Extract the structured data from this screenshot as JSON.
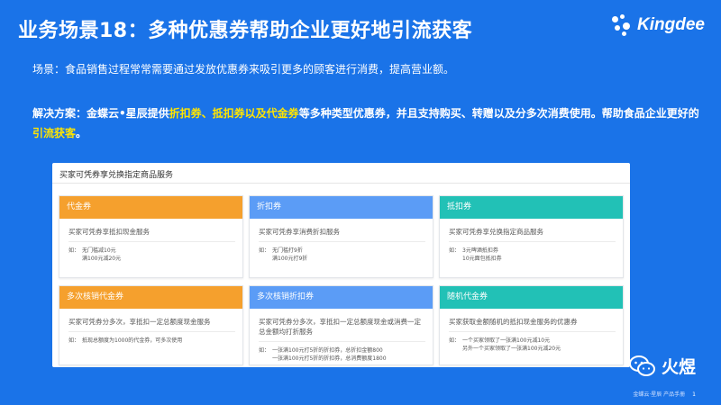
{
  "title": "业务场景18：多种优惠券帮助企业更好地引流获客",
  "logo_text": "Kingdee",
  "scene": "场景：食品销售过程常常需要通过发放优惠券来吸引更多的顾客进行消费，提高营业额。",
  "solution": {
    "prefix": "解决方案：金蝶云•星辰提供",
    "highlight1": "折扣券、抵扣券以及代金券",
    "middle": "等多种类型优惠券，并且支持购买、转赠以及分多次消费使用。帮助食品企业更好的",
    "highlight2": "引流获客",
    "suffix": "。"
  },
  "panel": {
    "heading": "买家可凭券享兑换指定商品服务",
    "cards": [
      {
        "title": "代金券",
        "color": "#f5a02d",
        "desc": "买家可凭券享抵扣现金服务",
        "ex_label": "如：",
        "ex_lines": [
          "无门槛减10元",
          "满100元减20元"
        ]
      },
      {
        "title": "折扣券",
        "color": "#5b9cf6",
        "desc": "买家可凭券享消费折扣服务",
        "ex_label": "如：",
        "ex_lines": [
          "无门槛打9折",
          "满100元打9折"
        ]
      },
      {
        "title": "抵扣券",
        "color": "#22c1b6",
        "desc": "买家可凭券享兑换指定商品服务",
        "ex_label": "如：",
        "ex_lines": [
          "3元啤酒抵扣券",
          "10元面包抵扣券"
        ]
      },
      {
        "title": "多次核销代金券",
        "color": "#f5a02d",
        "desc": "买家可凭券分多次，享抵扣一定总额度现金服务",
        "ex_label": "如：",
        "ex_lines": [
          "抵现总额度为1000的代金券，可多次使用"
        ]
      },
      {
        "title": "多次核销折扣券",
        "color": "#5b9cf6",
        "desc": "买家可凭券分多次，享抵扣一定总额度现金或消费一定总金额均打折服务",
        "ex_label": "如：",
        "ex_lines": [
          "一张满100元打5折的折扣券，总折扣金额800",
          "一张满100元打5折的折扣券，总消费额度1800"
        ]
      },
      {
        "title": "随机代金券",
        "color": "#22c1b6",
        "desc": "买家获取金额随机的抵扣现金服务的优惠券",
        "ex_label": "如：",
        "ex_lines": [
          "一个买家领取了一张满100元减10元",
          "另外一个买家领取了一张满100元减20元"
        ]
      }
    ]
  },
  "watermark": "火煜",
  "footer": {
    "left": "金蝶云·星辰 产品手册",
    "page": "1"
  }
}
